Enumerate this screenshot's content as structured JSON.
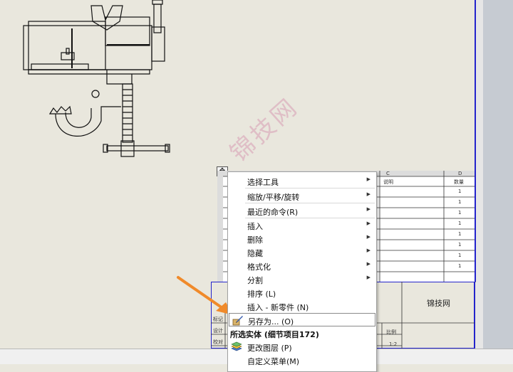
{
  "drawing": {
    "watermark": "锦技网",
    "bom": {
      "column_letters": [
        "C",
        "D"
      ],
      "headers": [
        "说明",
        "数量"
      ],
      "quantities": [
        "1",
        "1",
        "1",
        "1",
        "1",
        "1",
        "1",
        "1"
      ]
    },
    "title_block": {
      "company": "锦技网",
      "labels": [
        "标记",
        "设计",
        "校对",
        "比例"
      ],
      "scale": "1:2"
    }
  },
  "context_menu": {
    "items": [
      {
        "label": "选择工具",
        "submenu": true
      },
      {
        "label": "缩放/平移/旋转",
        "submenu": true
      },
      {
        "label": "最近的命令(R)",
        "submenu": true
      },
      {
        "label": "插入",
        "submenu": true
      },
      {
        "label": "删除",
        "submenu": true
      },
      {
        "label": "隐藏",
        "submenu": true
      },
      {
        "label": "格式化",
        "submenu": true
      },
      {
        "label": "分割",
        "submenu": true
      },
      {
        "label": "排序 (L)",
        "submenu": false
      },
      {
        "label": "插入 - 新零件 (N)",
        "submenu": false
      },
      {
        "label": "另存为... (O)",
        "submenu": false,
        "icon": "save-as-icon"
      },
      {
        "label": "所选实体 (细节项目172)",
        "header": true
      },
      {
        "label": "更改图层 (P)",
        "submenu": false,
        "icon": "layers-icon"
      },
      {
        "label": "自定义菜单(M)",
        "submenu": false
      }
    ]
  },
  "colors": {
    "sheet": "#e9e7dd",
    "border_blue": "#2323cc",
    "annotation_arrow": "#f08a2a"
  }
}
